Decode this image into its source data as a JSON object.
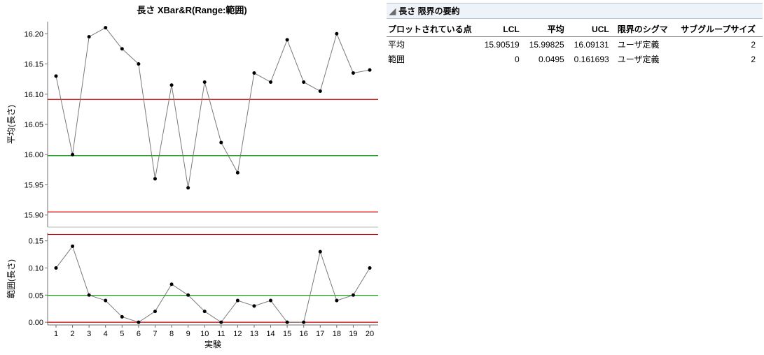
{
  "chart_title": "長さ  XBar&R(Range:範囲)",
  "chart_data": [
    {
      "type": "line",
      "title": "平均(長さ)",
      "x": [
        1,
        2,
        3,
        4,
        5,
        6,
        7,
        8,
        9,
        10,
        11,
        12,
        13,
        14,
        15,
        16,
        17,
        18,
        19,
        20
      ],
      "values": [
        16.13,
        16.0,
        16.195,
        16.21,
        16.175,
        16.15,
        15.96,
        16.115,
        15.945,
        16.12,
        16.02,
        15.97,
        16.135,
        16.12,
        16.19,
        16.12,
        16.105,
        16.2,
        16.135,
        16.14
      ],
      "ylabel": "平均(長さ)",
      "ylim": [
        15.88,
        16.22
      ],
      "grid_y": [
        15.9,
        15.95,
        16.0,
        16.05,
        16.1,
        16.15,
        16.2
      ],
      "center_line": 15.99825,
      "ucl": 16.09131,
      "lcl": 15.90519
    },
    {
      "type": "line",
      "title": "範囲(長さ)",
      "x": [
        1,
        2,
        3,
        4,
        5,
        6,
        7,
        8,
        9,
        10,
        11,
        12,
        13,
        14,
        15,
        16,
        17,
        18,
        19,
        20
      ],
      "values": [
        0.1,
        0.14,
        0.05,
        0.04,
        0.01,
        0.0,
        0.02,
        0.07,
        0.05,
        0.02,
        0.0,
        0.04,
        0.03,
        0.04,
        0.0,
        0.0,
        0.13,
        0.04,
        0.05,
        0.1
      ],
      "ylabel": "範囲(長さ)",
      "ylim": [
        -0.005,
        0.165
      ],
      "grid_y": [
        0.0,
        0.05,
        0.1,
        0.15
      ],
      "center_line": 0.0495,
      "ucl": 0.161693,
      "lcl": 0
    }
  ],
  "xlabel": "実験",
  "summary": {
    "header_title": "長さ 限界の要約",
    "columns": [
      "プロットされている点",
      "LCL",
      "平均",
      "UCL",
      "限界のシグマ",
      "サブグループサイズ"
    ],
    "rows": [
      {
        "label": "平均",
        "lcl": "15.90519",
        "mean": "15.99825",
        "ucl": "16.09131",
        "sigma": "ユーザ定義",
        "n": "2"
      },
      {
        "label": "範囲",
        "lcl": "0",
        "mean": "0.0495",
        "ucl": "0.161693",
        "sigma": "ユーザ定義",
        "n": "2"
      }
    ]
  }
}
